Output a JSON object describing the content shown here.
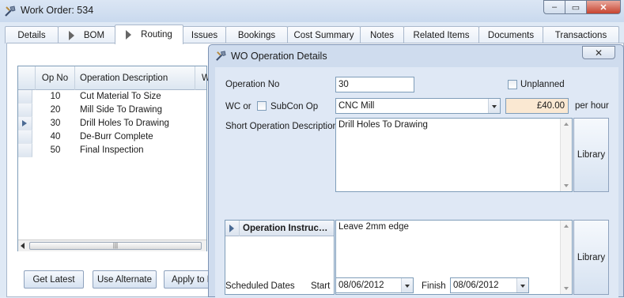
{
  "window": {
    "title": "Work Order: 534",
    "min_glyph": "‒",
    "max_glyph": "▭",
    "close_glyph": "✕"
  },
  "tabs": [
    {
      "label": "Details"
    },
    {
      "label": "BOM"
    },
    {
      "label": "Routing"
    },
    {
      "label": "Issues"
    },
    {
      "label": "Bookings"
    },
    {
      "label": "Cost Summary"
    },
    {
      "label": "Notes"
    },
    {
      "label": "Related Items"
    },
    {
      "label": "Documents"
    },
    {
      "label": "Transactions"
    }
  ],
  "routing": {
    "columns": {
      "op_no": "Op No",
      "description": "Operation Description",
      "wc": "W"
    },
    "rows": [
      {
        "op_no": "10",
        "description": "Cut Material To Size"
      },
      {
        "op_no": "20",
        "description": "Mill Side To Drawing"
      },
      {
        "op_no": "30",
        "description": "Drill Holes To Drawing"
      },
      {
        "op_no": "40",
        "description": "De-Burr Complete"
      },
      {
        "op_no": "50",
        "description": "Final Inspection"
      }
    ],
    "scroll_grip": "|||",
    "buttons": {
      "get_latest": "Get Latest",
      "use_alternate": "Use Alternate",
      "apply_to": "Apply to F"
    }
  },
  "dialog": {
    "title": "WO Operation Details",
    "close_glyph": "✕",
    "operation_no_label": "Operation No",
    "operation_no": "30",
    "unplanned_label": "Unplanned",
    "wc_label": "WC or",
    "subcon_label": "SubCon Op",
    "work_centre": "CNC Mill",
    "rate": "£40.00",
    "rate_unit": "per hour",
    "short_desc_label": "Short Operation Description",
    "short_desc": "Drill Holes To Drawing",
    "library_label": "Library",
    "instructions_header": "Operation Instruc…",
    "instructions": "Leave 2mm edge",
    "scheduled_label": "Scheduled Dates",
    "start_label": "Start",
    "start_date": "08/06/2012",
    "finish_label": "Finish",
    "finish_date": "08/06/2012"
  }
}
